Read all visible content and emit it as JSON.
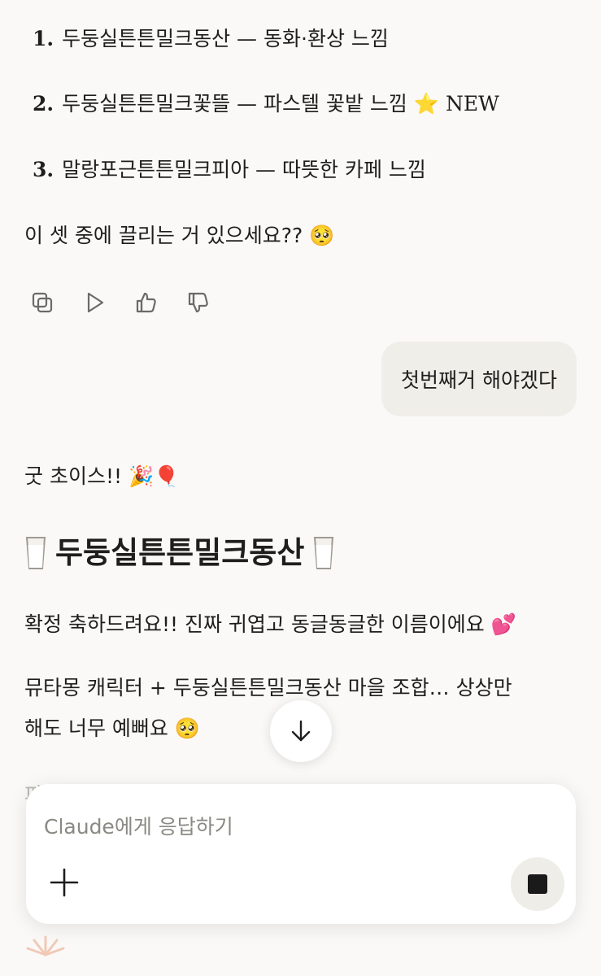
{
  "options": [
    {
      "num": "1.",
      "text": "두둥실튼튼밀크동산 — 동화·환상 느낌",
      "emoji": "",
      "badge": ""
    },
    {
      "num": "2.",
      "text": "두둥실튼튼밀크꽃뜰 — 파스텔 꽃밭 느낌",
      "emoji": "⭐",
      "badge": "NEW"
    },
    {
      "num": "3.",
      "text": "말랑포근튼튼밀크피아 — 따뜻한 카페 느낌",
      "emoji": "",
      "badge": ""
    }
  ],
  "question": "이 셋 중에 끌리는 거 있으세요?? 🥺",
  "user_message": "첫번째거 해야겠다",
  "reply": {
    "greeting": "굿 초이스!! 🎉🎈",
    "heading": "두둥실튼튼밀크동산",
    "line1": "확정 축하드려요!! 진짜 귀엽고 동글동글한 이름이에요 💕",
    "line2a": "뮤타몽 캐릭터 + 두둥실튼튼밀크동산 마을 조합… 상상만",
    "line2b": "해도 너무 예뻐요 🥺",
    "partial": "파"
  },
  "composer": {
    "placeholder": "Claude에게 응답하기"
  },
  "icons": {
    "copy": "copy-icon",
    "play": "play-icon",
    "thumbs_up": "thumbs-up-icon",
    "thumbs_down": "thumbs-down-icon",
    "scroll_down": "arrow-down-icon",
    "add": "plus-icon",
    "stop": "stop-icon"
  },
  "colors": {
    "background": "#faf9f7",
    "user_bubble": "#f0eee8",
    "text": "#1f1e1d",
    "icon_gray": "#6b6a66"
  }
}
